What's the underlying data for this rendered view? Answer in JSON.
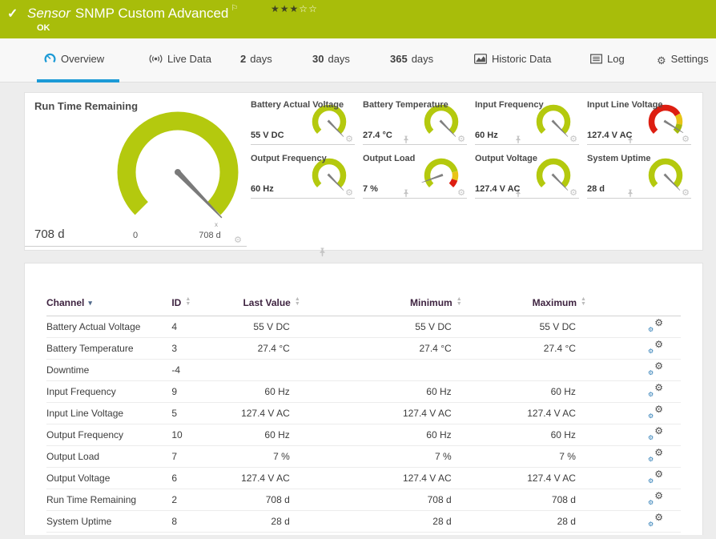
{
  "colors": {
    "topbar_green": "#a8bd0a",
    "gauge_green": "#b4c90e",
    "gauge_red": "#dd1e11",
    "gauge_yellow": "#e8c416",
    "accent_blue": "#1c9ad6",
    "table_header_text": "#3e2340"
  },
  "icons": {
    "topbar_status": "check-icon",
    "title_flag": "flag-icon",
    "rating": "star-icons",
    "tab_overview": "gauge-icon",
    "tab_live_data": "broadcast-icon",
    "tab_historic_data": "area-chart-icon",
    "tab_log": "log-icon",
    "tab_settings": "gear-icon",
    "tile_actions": [
      "gear-icon",
      "pin-icon"
    ],
    "row_action": "channel-settings-gears-icon",
    "column_sort": "sort-arrows-icon"
  },
  "topbar": {
    "type_label": "Sensor",
    "title": "SNMP Custom Advanced",
    "status": "OK",
    "stars_filled": 3,
    "stars_empty": 2
  },
  "tabs": [
    {
      "label": "Overview",
      "active": true
    },
    {
      "label": "Live Data"
    },
    {
      "prefix": "2",
      "label": "days"
    },
    {
      "prefix": "30",
      "label": "days"
    },
    {
      "prefix": "365",
      "label": "days"
    },
    {
      "label": "Historic Data"
    },
    {
      "label": "Log"
    },
    {
      "label": "Settings"
    }
  ],
  "overview": {
    "big_gauge": {
      "title": "Run Time Remaining",
      "value": "708 d",
      "scale_min": "0",
      "scale_max": "708 d",
      "marker": "x"
    },
    "mini_gauges": [
      {
        "label": "Battery Actual Voltage",
        "value": "55 V DC"
      },
      {
        "label": "Battery Temperature",
        "value": "27.4 °C"
      },
      {
        "label": "Input Frequency",
        "value": "60 Hz"
      },
      {
        "label": "Input Line Voltage",
        "value": "127.4 V AC"
      },
      {
        "label": "Output Frequency",
        "value": "60 Hz"
      },
      {
        "label": "Output Load",
        "value": "7 %"
      },
      {
        "label": "Output Voltage",
        "value": "127.4 V AC"
      },
      {
        "label": "System Uptime",
        "value": "28 d"
      }
    ]
  },
  "channel_table": {
    "headers": [
      "Channel",
      "ID",
      "Last Value",
      "Minimum",
      "Maximum"
    ],
    "rows": [
      {
        "channel": "Battery Actual Voltage",
        "id": "4",
        "last": "55 V DC",
        "min": "55 V DC",
        "max": "55 V DC"
      },
      {
        "channel": "Battery Temperature",
        "id": "3",
        "last": "27.4 °C",
        "min": "27.4 °C",
        "max": "27.4 °C"
      },
      {
        "channel": "Downtime",
        "id": "-4",
        "last": "",
        "min": "",
        "max": ""
      },
      {
        "channel": "Input Frequency",
        "id": "9",
        "last": "60 Hz",
        "min": "60 Hz",
        "max": "60 Hz"
      },
      {
        "channel": "Input Line Voltage",
        "id": "5",
        "last": "127.4 V AC",
        "min": "127.4 V AC",
        "max": "127.4 V AC"
      },
      {
        "channel": "Output Frequency",
        "id": "10",
        "last": "60 Hz",
        "min": "60 Hz",
        "max": "60 Hz"
      },
      {
        "channel": "Output Load",
        "id": "7",
        "last": "7 %",
        "min": "7 %",
        "max": "7 %"
      },
      {
        "channel": "Output Voltage",
        "id": "6",
        "last": "127.4 V AC",
        "min": "127.4 V AC",
        "max": "127.4 V AC"
      },
      {
        "channel": "Run Time Remaining",
        "id": "2",
        "last": "708 d",
        "min": "708 d",
        "max": "708 d"
      },
      {
        "channel": "System Uptime",
        "id": "8",
        "last": "28 d",
        "min": "28 d",
        "max": "28 d"
      }
    ]
  }
}
